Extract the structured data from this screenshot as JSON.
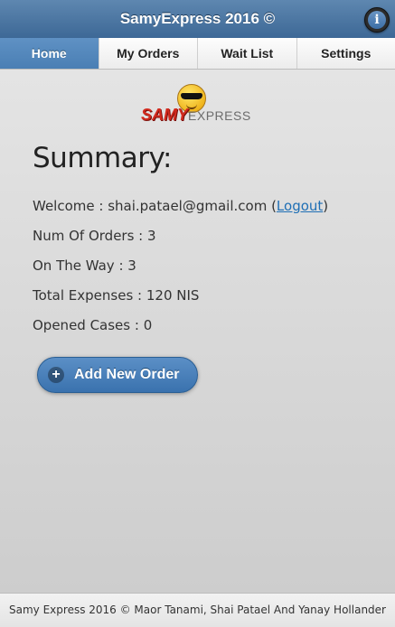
{
  "header": {
    "title": "SamyExpress 2016 ©",
    "info_icon": "info-icon",
    "info_glyph": "i"
  },
  "tabs": [
    {
      "label": "Home",
      "active": true
    },
    {
      "label": "My Orders",
      "active": false
    },
    {
      "label": "Wait List",
      "active": false
    },
    {
      "label": "Settings",
      "active": false
    }
  ],
  "logo": {
    "samy": "SAMY",
    "express": "EXPRESS"
  },
  "summary": {
    "title": "Summary:",
    "welcome_prefix": "Welcome : shai.patael@gmail.com (",
    "logout_label": "Logout",
    "welcome_suffix": ")",
    "num_orders": "Num Of Orders : 3",
    "on_the_way": "On The Way : 3",
    "total_expenses": "Total Expenses : 120 NIS",
    "opened_cases": "Opened Cases : 0"
  },
  "actions": {
    "add_order_label": "Add New Order",
    "add_order_icon": "plus-icon",
    "plus_glyph": "+"
  },
  "footer": {
    "text": "Samy Express 2016  ©   Maor Tanami, Shai Patael And Yanay Hollander"
  },
  "colors": {
    "header": "#4a76a3",
    "accent": "#4a7fb4",
    "background": "#d6d6d6",
    "link": "#1f6fb5",
    "logo_red": "#d22a1e"
  }
}
